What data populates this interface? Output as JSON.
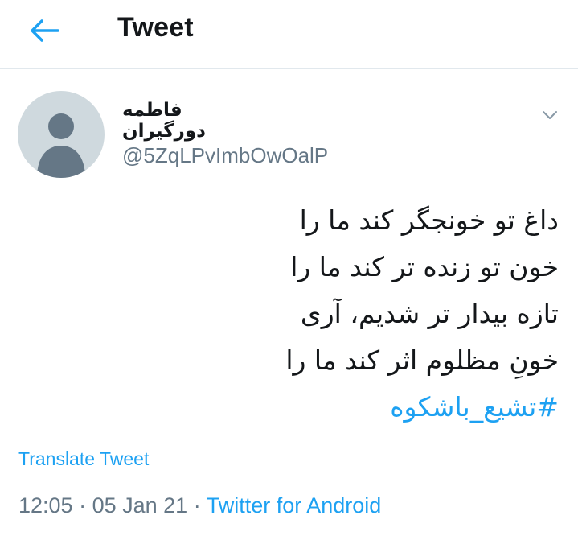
{
  "header": {
    "title": "Tweet",
    "back_icon": "arrow-left-icon"
  },
  "colors": {
    "accent": "#1da1f2",
    "secondary_text": "#657786",
    "avatar_bg": "#cfd9de",
    "avatar_silhouette": "#657786"
  },
  "tweet": {
    "author": {
      "display_name": "فاطمه دورگیران",
      "handle": "@5ZqLPvImbOwOalP"
    },
    "lines": [
      "داغ تو خونجگر کند ما را",
      "خون تو زنده تر کند ما را",
      "تازه بیدار تر شدیم، آری",
      "خونِ مظلوم اثر کند ما را"
    ],
    "hashtag": "#تشیع_باشکوه",
    "translate_label": "Translate Tweet",
    "time": "12:05",
    "date": "05 Jan 21",
    "separator": " · ",
    "source": "Twitter for Android"
  }
}
